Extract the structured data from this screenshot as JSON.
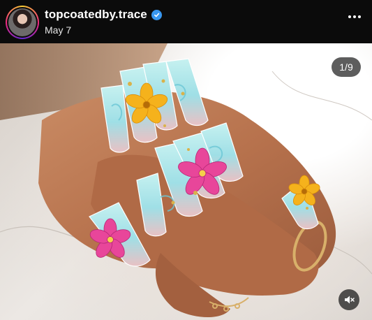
{
  "post": {
    "username": "topcoatedby.trace",
    "date": "May 7",
    "verified": true,
    "avatar_icon": "profile-photo"
  },
  "carousel": {
    "counter": "1/9"
  },
  "icons": {
    "more": "more-horizontal-icon",
    "mute": "speaker-muted-icon",
    "verified": "verified-badge-icon"
  },
  "colors": {
    "header_bg": "#0b0b0b",
    "verified_blue": "#3897f0",
    "nail_blue": "#a8e4e8",
    "flower_pink": "#e8469a",
    "flower_yellow": "#f5b21c"
  }
}
